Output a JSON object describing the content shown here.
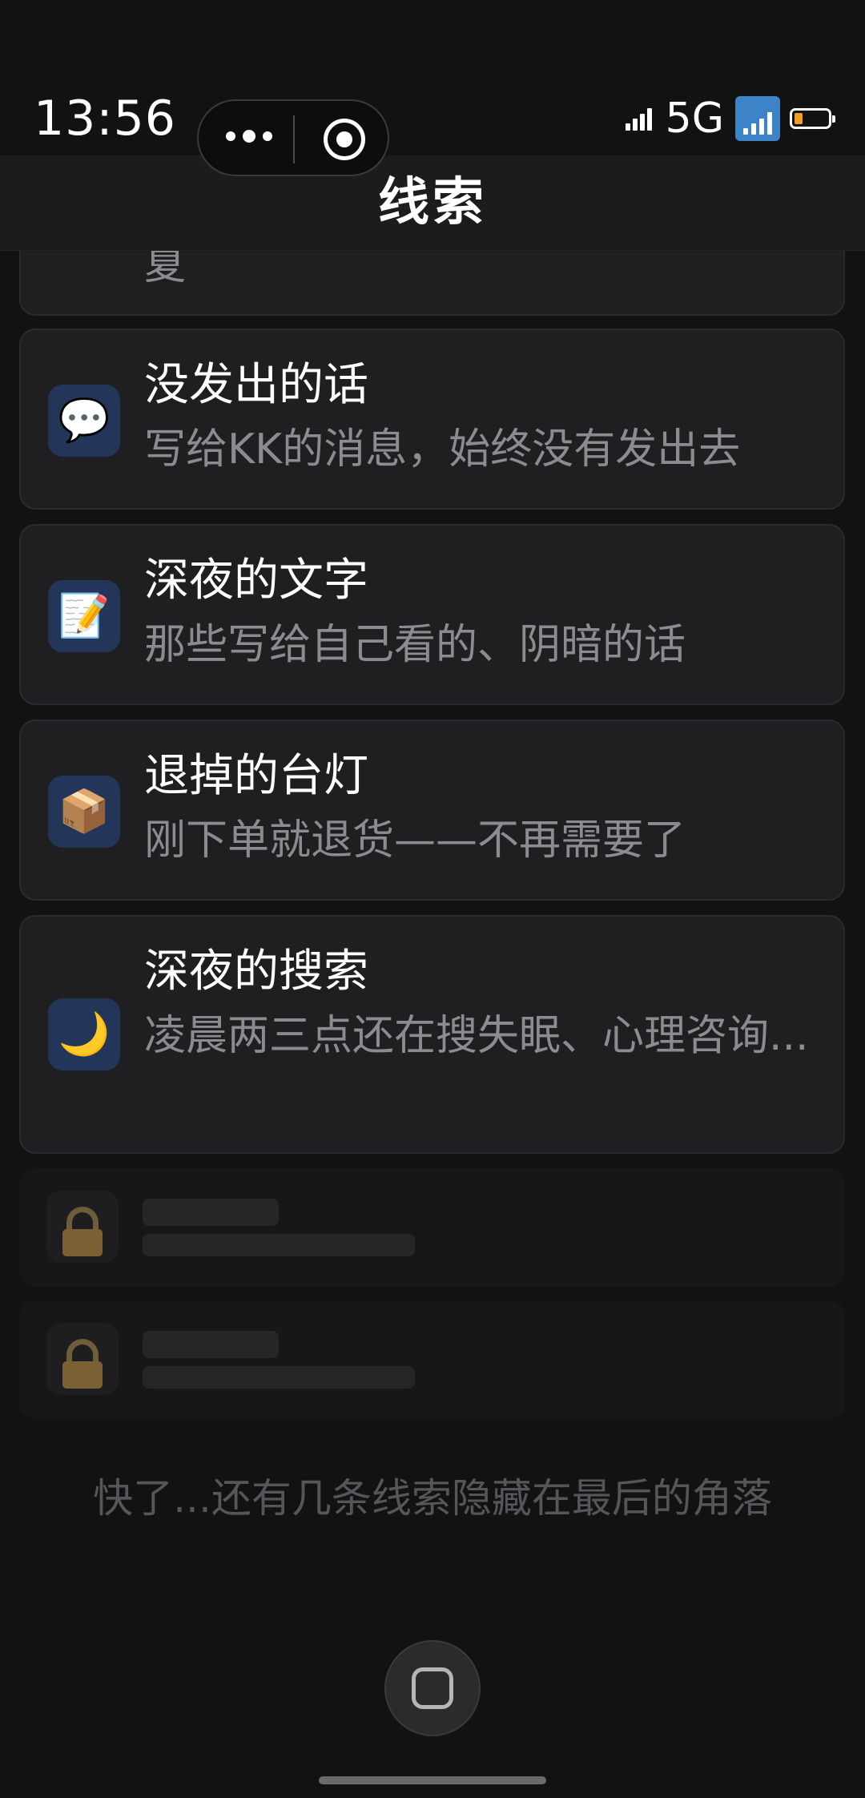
{
  "status_bar": {
    "time": "13:56",
    "network": "5G",
    "battery_level": 0.25
  },
  "header": {
    "title": "线索"
  },
  "capsule": {
    "more_icon": "more-dots-icon",
    "close_icon": "target-circle-icon"
  },
  "clues": {
    "partial_desc": "夏",
    "items": [
      {
        "icon": "💬",
        "icon_name": "speech-bubble-icon",
        "title": "没发出的话",
        "desc": "写给KK的消息，始终没有发出去"
      },
      {
        "icon": "📝",
        "icon_name": "memo-icon",
        "title": "深夜的文字",
        "desc": "那些写给自己看的、阴暗的话"
      },
      {
        "icon": "📦",
        "icon_name": "package-icon",
        "title": "退掉的台灯",
        "desc": "刚下单就退货——不再需要了"
      },
      {
        "icon": "🌙",
        "icon_name": "crescent-moon-icon",
        "title": "深夜的搜索",
        "desc": "凌晨两三点还在搜失眠、心理咨询..."
      }
    ]
  },
  "footer": {
    "note": "快了...还有几条线索隐藏在最后的角落"
  },
  "colors": {
    "background": "#121213",
    "card": "#1f1f21",
    "icon_tile": "#233659",
    "muted_text": "#8b8c90",
    "lock": "#7a6033"
  }
}
